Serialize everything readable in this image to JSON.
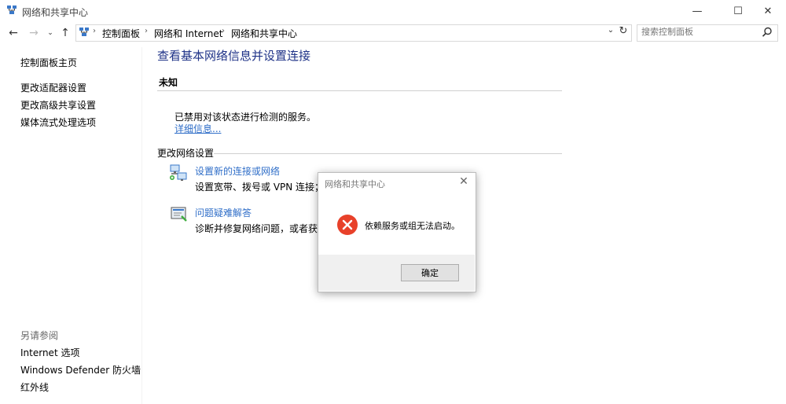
{
  "window": {
    "title": "网络和共享中心",
    "minimize_glyph": "—",
    "maximize_glyph": "☐",
    "close_glyph": "✕"
  },
  "nav": {
    "back_glyph": "←",
    "forward_glyph": "→",
    "recent_glyph": "⌄",
    "up_glyph": "↑",
    "breadcrumb": [
      "控制面板",
      "网络和 Internet",
      "网络和共享中心"
    ],
    "separator": "›",
    "dropdown_glyph": "⌄",
    "refresh_glyph": "↻"
  },
  "search": {
    "placeholder": "搜索控制面板"
  },
  "left_pane": {
    "home": "控制面板主页",
    "adapter": "更改适配器设置",
    "advanced_sharing": "更改高级共享设置",
    "media_streaming": "媒体流式处理选项",
    "see_also": "另请参阅",
    "internet_options": "Internet 选项",
    "defender": "Windows Defender 防火墙",
    "infrared": "红外线"
  },
  "main": {
    "title": "查看基本网络信息并设置连接",
    "network_name": "未知",
    "disabled_message": "已禁用对该状态进行检测的服务。",
    "more_info": "详细信息...",
    "change_settings": "更改网络设置",
    "setup_link": "设置新的连接或网络",
    "setup_desc": "设置宽带、拨号或 VPN 连接；或",
    "trouble_link": "问题疑难解答",
    "trouble_desc": "诊断并修复网络问题，或者获得疑"
  },
  "dialog": {
    "title": "网络和共享中心",
    "close_glyph": "✕",
    "message": "依赖服务或组无法启动。",
    "ok_label": "确定"
  },
  "colors": {
    "title_blue": "#1e3287",
    "link_blue": "#2f6ec8",
    "error_red": "#e81123"
  }
}
